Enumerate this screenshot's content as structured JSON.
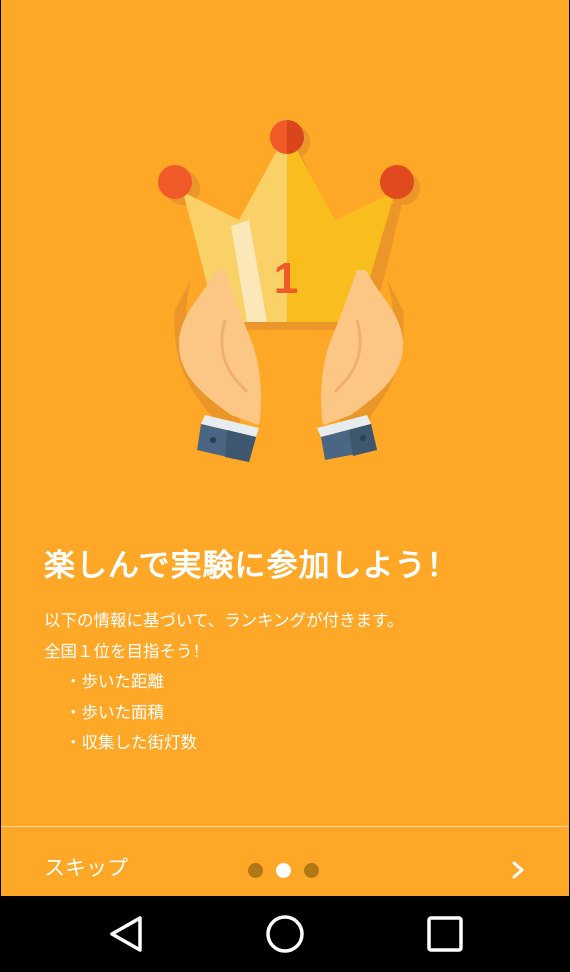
{
  "onboarding": {
    "title": "楽しんで実験に参加しよう！",
    "description_lines": [
      "以下の情報に基づいて、ランキングが付きます。",
      "全国１位を目指そう！"
    ],
    "bullets": [
      "・歩いた距離",
      "・歩いた面積",
      "・収集した街灯数"
    ],
    "crown_number": "1",
    "background_color": "#FFA726"
  },
  "footer": {
    "skip_label": "スキップ",
    "page_indicator": {
      "total": 3,
      "current": 2
    },
    "next_icon": "chevron-right-icon"
  },
  "navbar": {
    "icons": [
      "back-icon",
      "home-icon",
      "recents-icon"
    ]
  }
}
